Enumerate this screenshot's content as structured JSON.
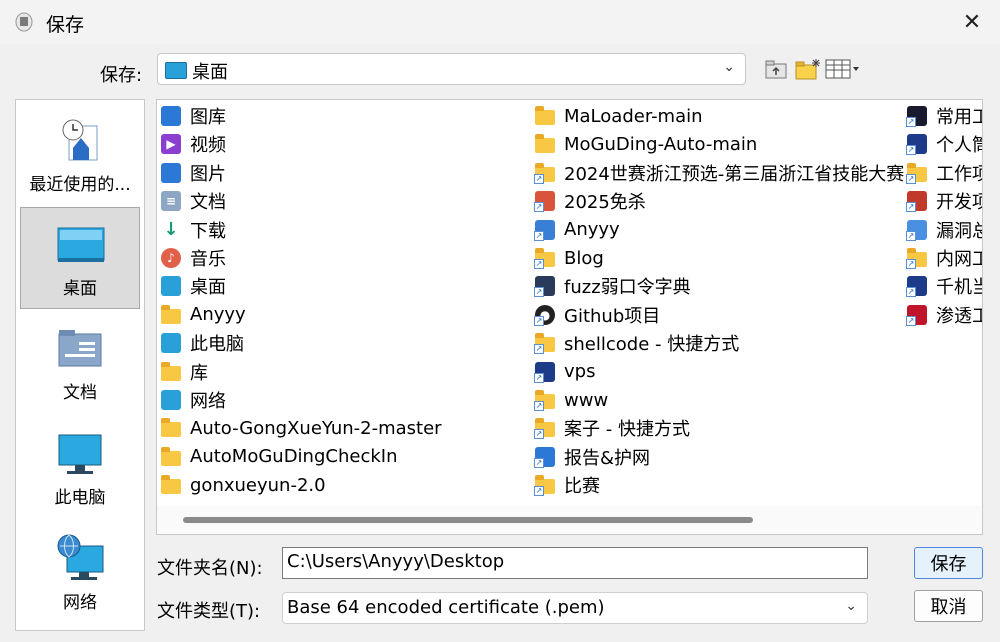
{
  "window": {
    "title": "保存"
  },
  "save_in": {
    "label": "保存:",
    "value": "桌面"
  },
  "places": [
    {
      "label": "最近使用的...",
      "icon": "recent-icon"
    },
    {
      "label": "桌面",
      "icon": "desktop-icon",
      "selected": true
    },
    {
      "label": "文档",
      "icon": "documents-icon"
    },
    {
      "label": "此电脑",
      "icon": "computer-icon"
    },
    {
      "label": "网络",
      "icon": "network-icon"
    }
  ],
  "files": [
    {
      "label": "图库",
      "icon": "gallery-icon",
      "color": "#2b78d6"
    },
    {
      "label": "视频",
      "icon": "video-icon",
      "color": "#8a3fd1"
    },
    {
      "label": "图片",
      "icon": "pictures-icon",
      "color": "#2b78d6"
    },
    {
      "label": "文档",
      "icon": "document-icon",
      "color": "#8da6c4"
    },
    {
      "label": "下载",
      "icon": "download-icon",
      "color": "#1a9b75"
    },
    {
      "label": "音乐",
      "icon": "music-icon",
      "color": "#e0604a"
    },
    {
      "label": "桌面",
      "icon": "desktop-icon",
      "color": "#2aa0d8"
    },
    {
      "label": "Anyyy",
      "icon": "folder-icon"
    },
    {
      "label": "此电脑",
      "icon": "computer-icon",
      "color": "#2aa0d8"
    },
    {
      "label": "库",
      "icon": "folder-icon"
    },
    {
      "label": "网络",
      "icon": "network-icon",
      "color": "#2aa0d8"
    },
    {
      "label": "Auto-GongXueYun-2-master",
      "icon": "folder-icon"
    },
    {
      "label": "AutoMoGuDingCheckIn",
      "icon": "folder-icon"
    },
    {
      "label": "gonxueyun-2.0",
      "icon": "folder-icon"
    },
    {
      "label": "MaLoader-main",
      "icon": "folder-icon"
    },
    {
      "label": "MoGuDing-Auto-main",
      "icon": "folder-icon"
    },
    {
      "label": "2024世赛浙江预选-第三届浙江省技能大赛",
      "icon": "folder-shortcut-icon"
    },
    {
      "label": "2025免杀",
      "icon": "shortcut-icon",
      "color": "#d8543a"
    },
    {
      "label": "Anyyy",
      "icon": "shortcut-icon",
      "color": "#3a7fd6"
    },
    {
      "label": "Blog",
      "icon": "folder-shortcut-icon"
    },
    {
      "label": "fuzz弱口令字典",
      "icon": "shortcut-icon",
      "color": "#2a3a5a"
    },
    {
      "label": "Github项目",
      "icon": "github-icon",
      "color": "#222222"
    },
    {
      "label": "shellcode - 快捷方式",
      "icon": "folder-shortcut-icon"
    },
    {
      "label": "vps",
      "icon": "shortcut-icon",
      "color": "#1e3b8a"
    },
    {
      "label": "www",
      "icon": "folder-shortcut-icon"
    },
    {
      "label": "案子 - 快捷方式",
      "icon": "folder-shortcut-icon"
    },
    {
      "label": "报告&护网",
      "icon": "shortcut-icon",
      "color": "#2b78d6"
    },
    {
      "label": "比赛",
      "icon": "folder-shortcut-icon"
    },
    {
      "label": "常用工",
      "icon": "shortcut-icon",
      "color": "#1a1a2e"
    },
    {
      "label": "个人筒",
      "icon": "shortcut-icon",
      "color": "#1e3b8a"
    },
    {
      "label": "工作项",
      "icon": "folder-shortcut-icon"
    },
    {
      "label": "开发项",
      "icon": "shortcut-icon",
      "color": "#c0392b"
    },
    {
      "label": "漏洞总",
      "icon": "shortcut-icon",
      "color": "#4a90e2"
    },
    {
      "label": "内网工",
      "icon": "folder-shortcut-icon"
    },
    {
      "label": "千机当",
      "icon": "shortcut-icon",
      "color": "#1e3b8a"
    },
    {
      "label": "渗透工",
      "icon": "shortcut-icon",
      "color": "#c0142b"
    }
  ],
  "filename": {
    "label": "文件夹名(N):",
    "value": "C:\\Users\\Anyyy\\Desktop"
  },
  "filetype": {
    "label": "文件类型(T):",
    "value": "Base 64 encoded certificate (.pem)"
  },
  "buttons": {
    "save": "保存",
    "cancel": "取消"
  }
}
